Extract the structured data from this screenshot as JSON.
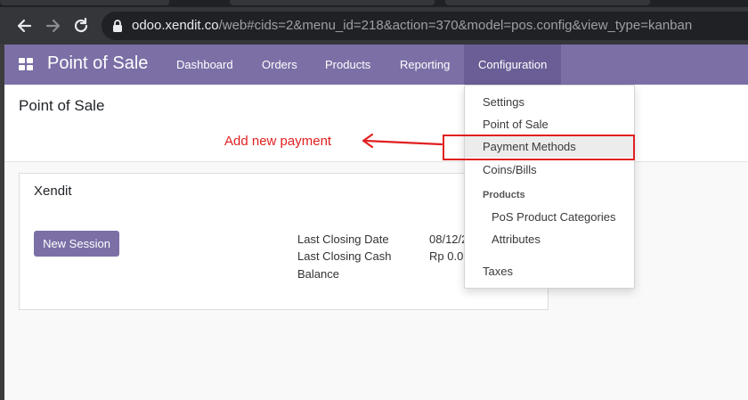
{
  "browser": {
    "url_host": "odoo.xendit.co",
    "url_path": "/web#cids=2&menu_id=218&action=370&model=pos.config&view_type=kanban"
  },
  "topnav": {
    "app_name": "Point of Sale",
    "menu": [
      "Dashboard",
      "Orders",
      "Products",
      "Reporting",
      "Configuration"
    ],
    "active_menu": "Configuration"
  },
  "page": {
    "title": "Point of Sale"
  },
  "card": {
    "title": "Xendit",
    "button_label": "New Session",
    "stats": [
      {
        "label": "Last Closing Date",
        "value": "08/12/2"
      },
      {
        "label": "Last Closing Cash",
        "value": "Rp 0.0"
      },
      {
        "label": "Balance",
        "value": ""
      }
    ]
  },
  "dropdown": {
    "items": [
      "Settings",
      "Point of Sale",
      "Payment Methods",
      "Coins/Bills"
    ],
    "section_header": "Products",
    "sub_items": [
      "PoS Product Categories",
      "Attributes"
    ],
    "footer_item": "Taxes",
    "highlighted": "Payment Methods"
  },
  "annotation": {
    "text": "Add new payment"
  },
  "colors": {
    "brand": "#7c6fa6",
    "annotation": "#e02020"
  },
  "icons": [
    "back-arrow-icon",
    "forward-arrow-icon",
    "reload-icon",
    "lock-icon",
    "apps-grid-icon",
    "annotation-arrow-icon"
  ]
}
